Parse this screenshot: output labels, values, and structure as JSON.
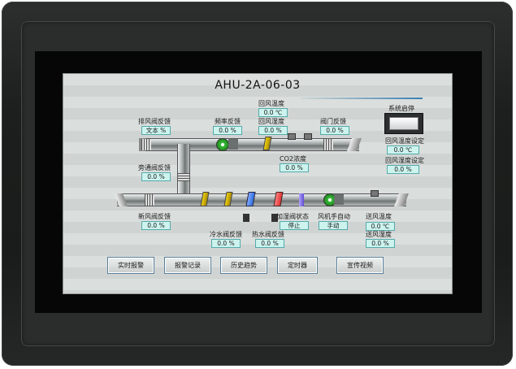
{
  "title": "AHU-2A-06-03",
  "exhaust_damper": {
    "label": "排风阀反馈",
    "value": "文本 %"
  },
  "freq": {
    "label": "频率反馈",
    "value": "0.0 %"
  },
  "return_temp": {
    "label": "回风温度",
    "value": "0.0 ℃"
  },
  "return_hum": {
    "label": "回风湿度",
    "value": "0.0 %"
  },
  "valve_fb": {
    "label": "阀门反馈",
    "value": "0.0 %"
  },
  "system_start": {
    "label": "系统启停"
  },
  "return_temp_set": {
    "label": "回风温度设定",
    "value": "0.0 ℃"
  },
  "return_hum_set": {
    "label": "回风湿度设定",
    "value": "0.0 %"
  },
  "bypass": {
    "label": "旁通阀反馈",
    "value": "0.0 %"
  },
  "co2": {
    "label": "CO2浓度",
    "value": "0.0 %"
  },
  "fresh_air": {
    "label": "新风阀反馈",
    "value": "0.0 %"
  },
  "humid_state": {
    "label": "加湿阀状态",
    "value": "停止"
  },
  "fan_mode": {
    "label": "风机手自动",
    "value": "手动"
  },
  "supply_temp": {
    "label": "送风温度",
    "value": "0.0 ℃"
  },
  "supply_hum": {
    "label": "送风湿度",
    "value": "0.0 %"
  },
  "cold_valve": {
    "label": "冷水阀反馈",
    "value": "0.0 %"
  },
  "hot_valve": {
    "label": "热水阀反馈",
    "value": "0.0 %"
  },
  "buttons": [
    "实时报警",
    "报警记录",
    "历史趋势",
    "定时器",
    "宣传视频"
  ],
  "colors": {
    "value_bg": "#cdf3ee",
    "fan": "#3cbf3c",
    "filter_yellow": "#f0d010",
    "cooling_coil": "#2f6fe0",
    "heating_coil": "#e03030"
  }
}
